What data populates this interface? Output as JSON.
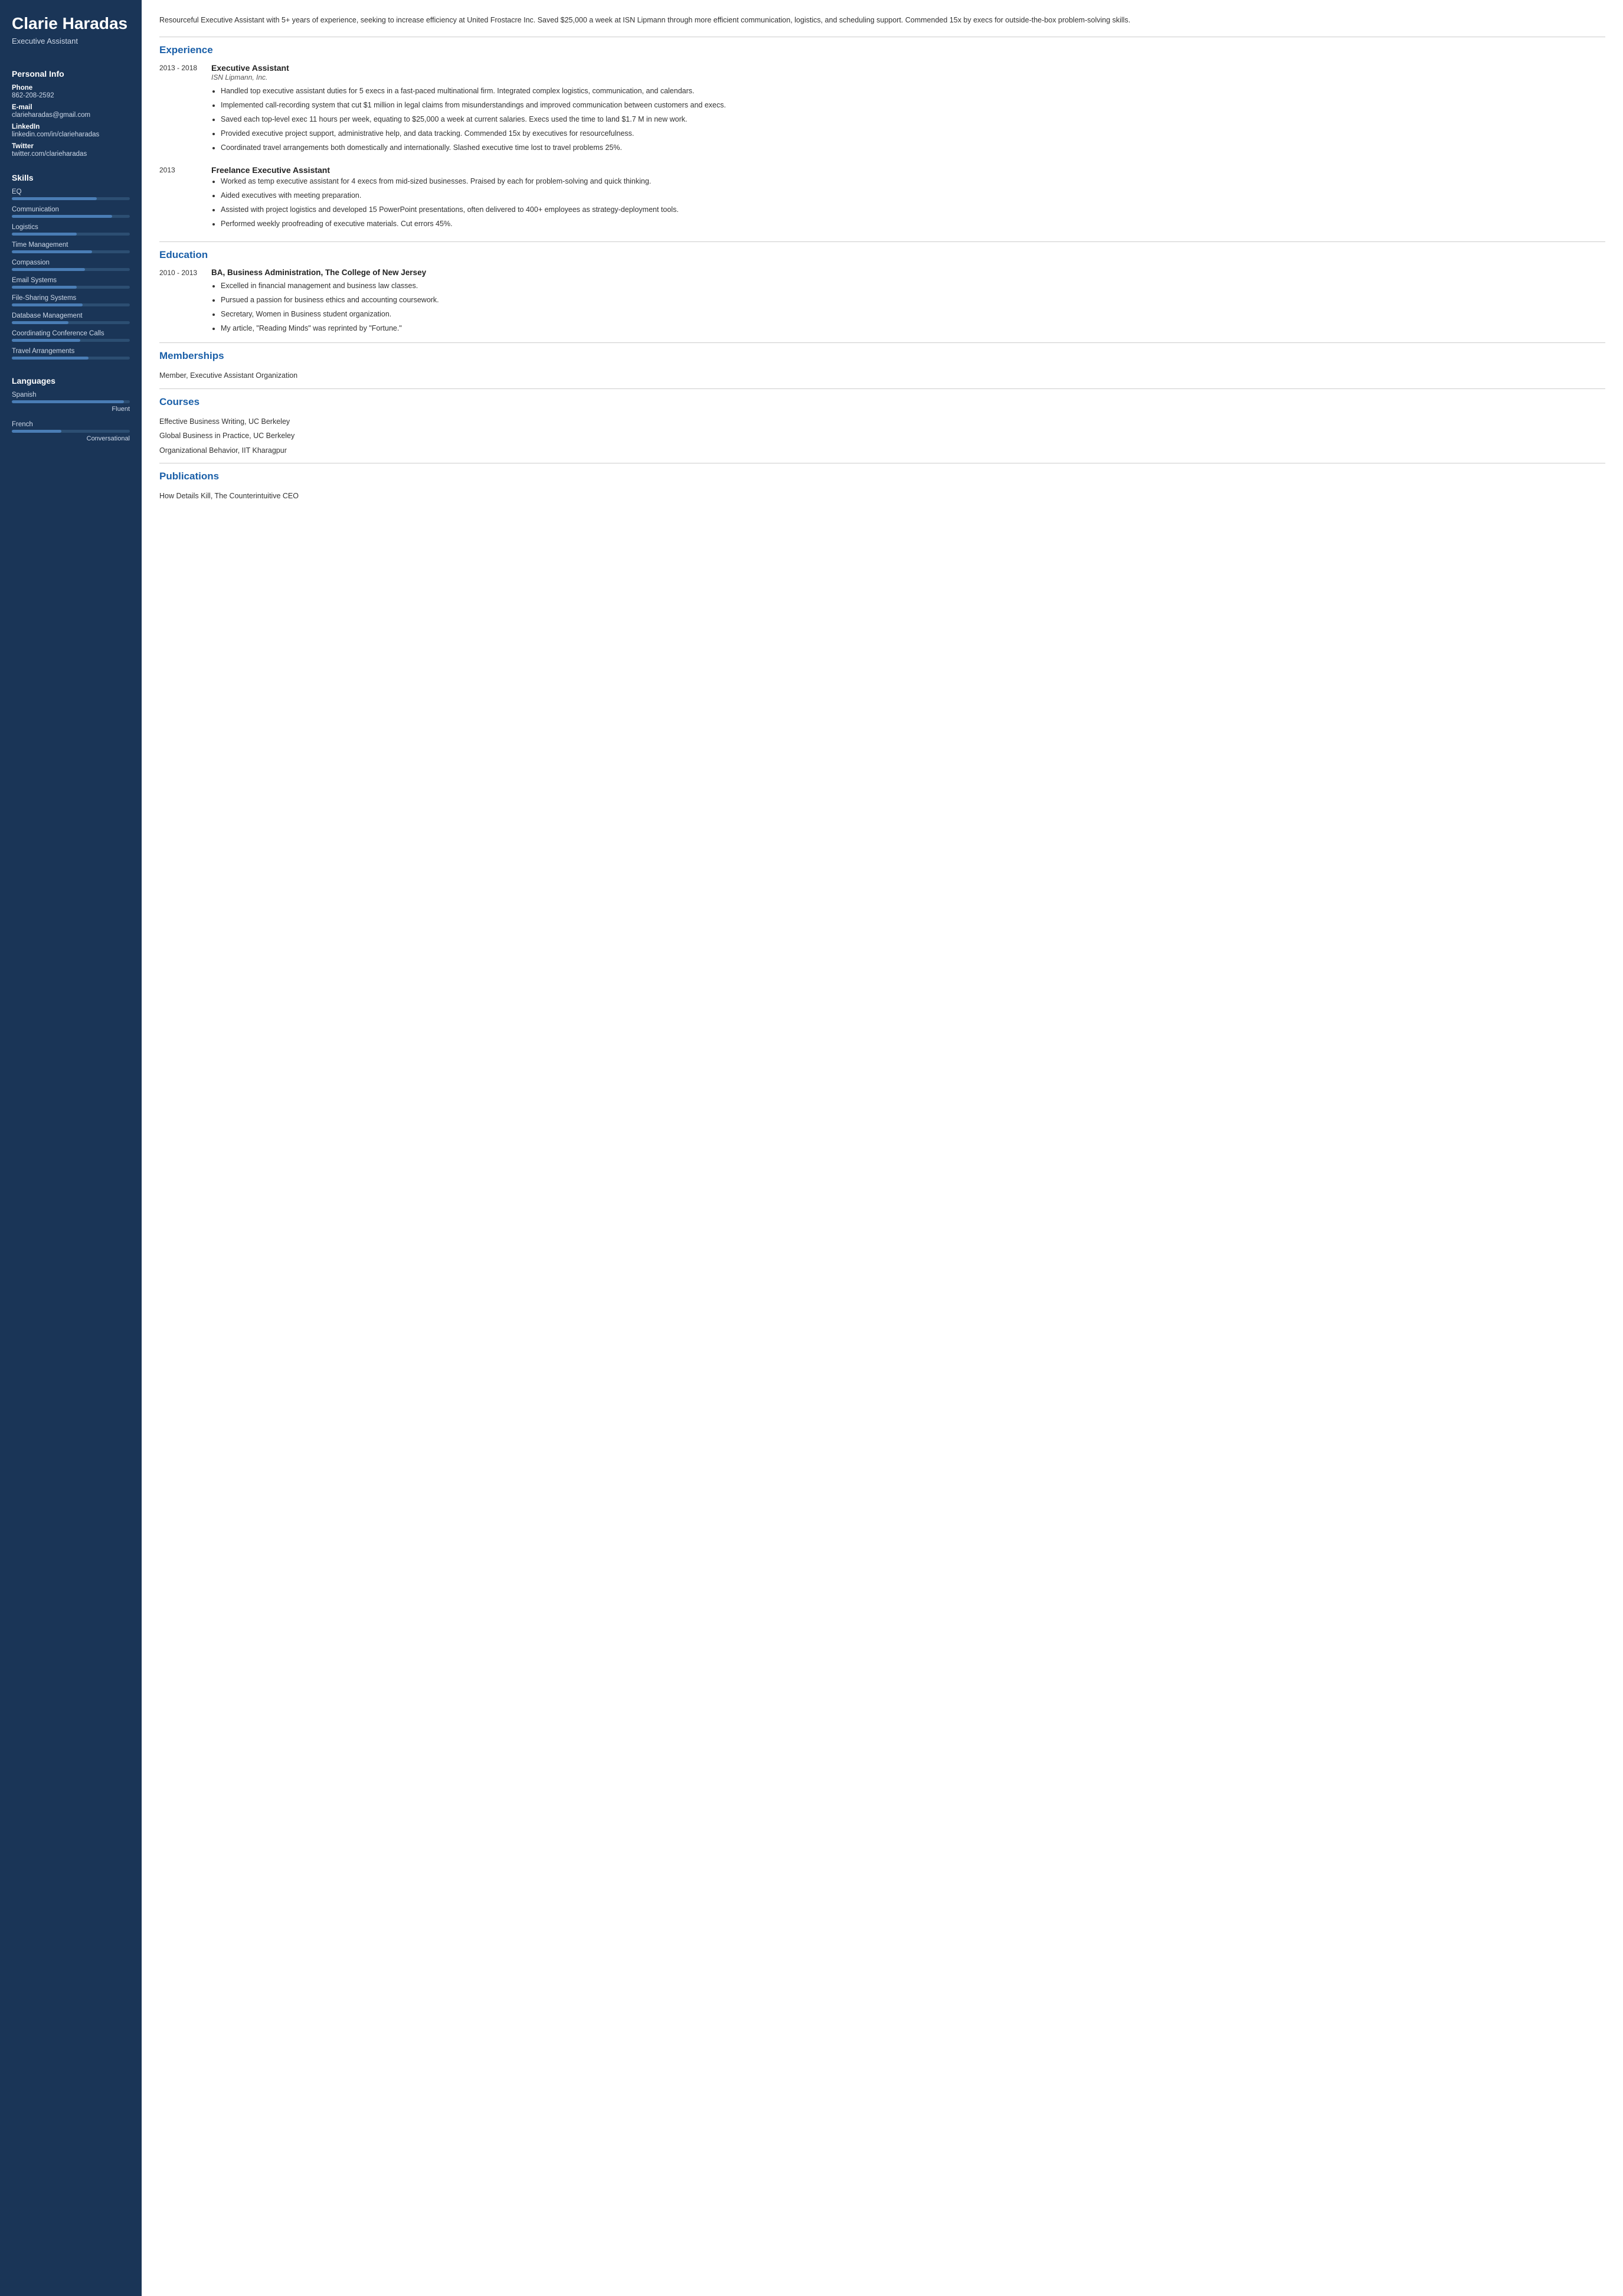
{
  "sidebar": {
    "name": "Clarie Haradas",
    "job_title": "Executive Assistant",
    "personal_info": {
      "section_title": "Personal Info",
      "phone_label": "Phone",
      "phone": "862-208-2592",
      "email_label": "E-mail",
      "email": "clarieharadas@gmail.com",
      "linkedin_label": "LinkedIn",
      "linkedin": "linkedin.com/in/clarieharadas",
      "twitter_label": "Twitter",
      "twitter": "twitter.com/clarieharadas"
    },
    "skills": {
      "section_title": "Skills",
      "items": [
        {
          "name": "EQ",
          "pct": 72
        },
        {
          "name": "Communication",
          "pct": 85
        },
        {
          "name": "Logistics",
          "pct": 55
        },
        {
          "name": "Time Management",
          "pct": 68
        },
        {
          "name": "Compassion",
          "pct": 62
        },
        {
          "name": "Email Systems",
          "pct": 55
        },
        {
          "name": "File-Sharing Systems",
          "pct": 60
        },
        {
          "name": "Database Management",
          "pct": 48
        },
        {
          "name": "Coordinating Conference Calls",
          "pct": 58
        },
        {
          "name": "Travel Arrangements",
          "pct": 65
        }
      ]
    },
    "languages": {
      "section_title": "Languages",
      "items": [
        {
          "name": "Spanish",
          "pct": 95,
          "level": "Fluent"
        },
        {
          "name": "French",
          "pct": 42,
          "level": "Conversational"
        }
      ]
    }
  },
  "main": {
    "summary": "Resourceful Executive Assistant with 5+ years of experience, seeking to increase efficiency at United Frostacre Inc. Saved $25,000 a week at ISN Lipmann through more efficient communication, logistics, and scheduling support. Commended 15x by execs for outside-the-box problem-solving skills.",
    "experience": {
      "section_title": "Experience",
      "entries": [
        {
          "date": "2013 - 2018",
          "title": "Executive Assistant",
          "company": "ISN Lipmann, Inc.",
          "bullets": [
            "Handled top executive assistant duties for 5 execs in a fast-paced multinational firm. Integrated complex logistics, communication, and calendars.",
            "Implemented call-recording system that cut $1 million in legal claims from misunderstandings and improved communication between customers and execs.",
            "Saved each top-level exec 11 hours per week, equating to $25,000 a week at current salaries. Execs used the time to land $1.7 M in new work.",
            "Provided executive project support, administrative help, and data tracking. Commended 15x by executives for resourcefulness.",
            "Coordinated travel arrangements both domestically and internationally. Slashed executive time lost to travel problems 25%."
          ]
        },
        {
          "date": "2013",
          "title": "Freelance Executive Assistant",
          "company": "",
          "bullets": [
            "Worked as temp executive assistant for 4 execs from mid-sized businesses. Praised by each for problem-solving and quick thinking.",
            "Aided executives with meeting preparation.",
            "Assisted with project logistics and developed 15 PowerPoint presentations, often delivered to 400+ employees as strategy-deployment tools.",
            "Performed weekly proofreading of executive materials. Cut errors 45%."
          ]
        }
      ]
    },
    "education": {
      "section_title": "Education",
      "entries": [
        {
          "date": "2010 - 2013",
          "degree": "BA, Business Administration, The College of New Jersey",
          "bullets": [
            "Excelled in financial management and business law classes.",
            "Pursued a passion for business ethics and accounting coursework.",
            "Secretary, Women in Business student organization.",
            "My article, \"Reading Minds\" was reprinted by \"Fortune.\""
          ]
        }
      ]
    },
    "memberships": {
      "section_title": "Memberships",
      "items": [
        "Member, Executive Assistant Organization"
      ]
    },
    "courses": {
      "section_title": "Courses",
      "items": [
        "Effective Business Writing, UC Berkeley",
        "Global Business in Practice, UC Berkeley",
        "Organizational Behavior, IIT Kharagpur"
      ]
    },
    "publications": {
      "section_title": "Publications",
      "items": [
        "How Details Kill, The Counterintuitive CEO"
      ]
    }
  }
}
